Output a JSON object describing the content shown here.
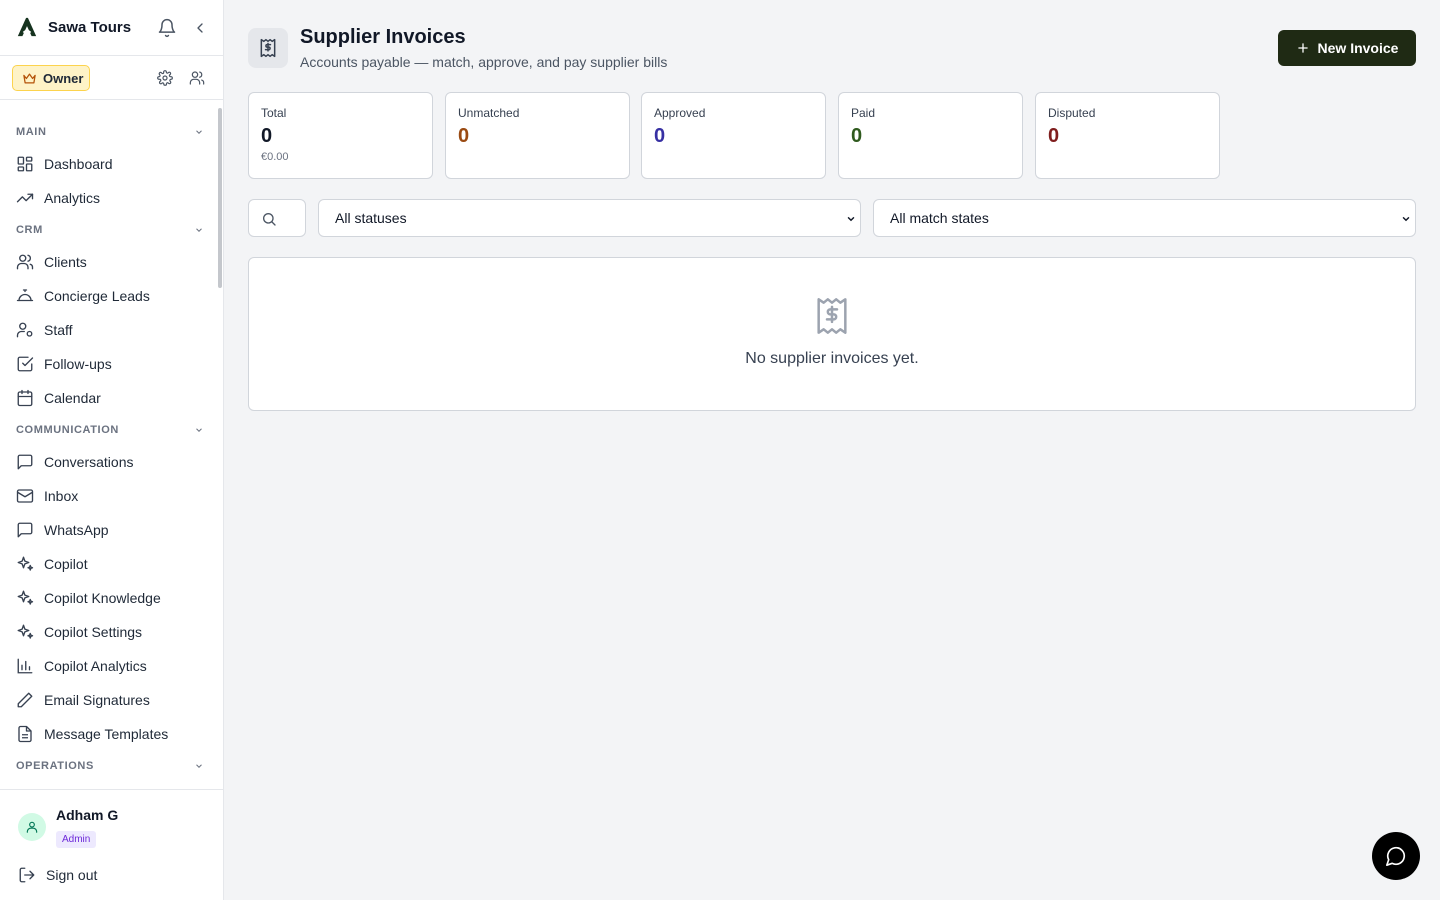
{
  "brand": {
    "name": "Sawa Tours"
  },
  "role_badge": {
    "label": "Owner"
  },
  "nav": {
    "sections": [
      {
        "label": "MAIN",
        "items": [
          "Dashboard",
          "Analytics"
        ]
      },
      {
        "label": "CRM",
        "items": [
          "Clients",
          "Concierge Leads",
          "Staff",
          "Follow-ups",
          "Calendar"
        ]
      },
      {
        "label": "COMMUNICATION",
        "items": [
          "Conversations",
          "Inbox",
          "WhatsApp",
          "Copilot",
          "Copilot Knowledge",
          "Copilot Settings",
          "Copilot Analytics",
          "Email Signatures",
          "Message Templates"
        ]
      },
      {
        "label": "OPERATIONS",
        "items": []
      }
    ]
  },
  "user": {
    "name": "Adham G",
    "role": "Admin",
    "signout_label": "Sign out"
  },
  "header": {
    "title": "Supplier Invoices",
    "subtitle": "Accounts payable — match, approve, and pay supplier bills",
    "new_button": "New Invoice"
  },
  "stats": [
    {
      "label": "Total",
      "value": "0",
      "sub": "€0.00",
      "color": "#111827"
    },
    {
      "label": "Unmatched",
      "value": "0",
      "color": "#9a4a12"
    },
    {
      "label": "Approved",
      "value": "0",
      "color": "#3730a3"
    },
    {
      "label": "Paid",
      "value": "0",
      "color": "#2f5a1e"
    },
    {
      "label": "Disputed",
      "value": "0",
      "color": "#7f1d1d"
    }
  ],
  "filters": {
    "status": {
      "selected": "All statuses"
    },
    "match": {
      "selected": "All match states"
    }
  },
  "empty_state": {
    "message": "No supplier invoices yet."
  },
  "colors": {
    "accent": "#1f2a14",
    "owner_badge_bg": "#fef3c7",
    "admin_badge_bg": "#ede9fe"
  }
}
